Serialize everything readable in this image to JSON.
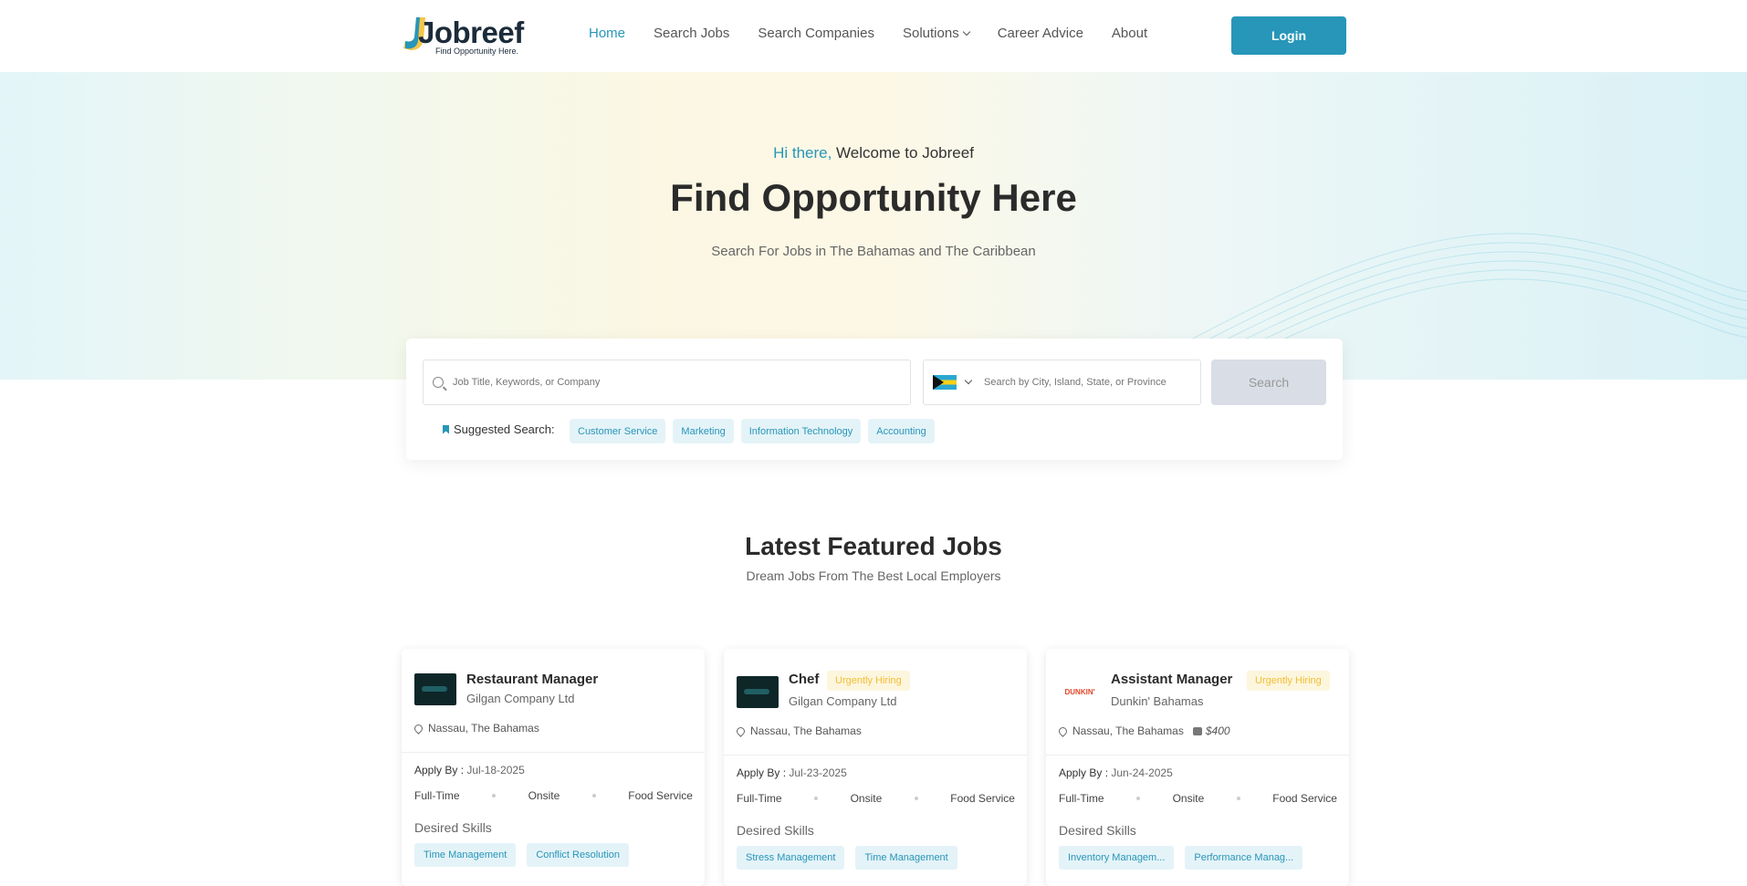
{
  "header": {
    "logo_text": "Jobreef",
    "logo_tagline": "Find Opportunity Here.",
    "nav": [
      {
        "label": "Home",
        "active": true
      },
      {
        "label": "Search Jobs"
      },
      {
        "label": "Search Companies"
      },
      {
        "label": "Solutions"
      },
      {
        "label": "Career Advice"
      },
      {
        "label": "About"
      }
    ],
    "login_label": "Login"
  },
  "hero": {
    "greeting_highlight": "Hi there,",
    "greeting_rest": "Welcome to Jobreef",
    "title": "Find Opportunity Here",
    "subtitle": "Search For Jobs in The Bahamas and The Caribbean"
  },
  "search": {
    "keyword_placeholder": "Job Title, Keywords, or Company",
    "location_placeholder": "Search by City, Island, State, or Province",
    "country_flag": "bahamas-flag",
    "button_label": "Search",
    "suggested_label": "Suggested Search:",
    "suggestions": [
      "Customer Service",
      "Marketing",
      "Information Technology",
      "Accounting"
    ]
  },
  "featured": {
    "title": "Latest Featured Jobs",
    "subtitle": "Dream Jobs From The Best Local Employers"
  },
  "jobs": [
    {
      "title": "Restaurant Manager",
      "urgent": "",
      "company": "Gilgan Company Ltd",
      "location": "Nassau, The Bahamas",
      "salary": "",
      "apply_label": "Apply By :",
      "apply_date": "Jul-18-2025",
      "type": "Full-Time",
      "mode": "Onsite",
      "category": "Food Service",
      "skills_heading": "Desired Skills",
      "skills": [
        "Time Management",
        "Conflict Resolution"
      ]
    },
    {
      "title": "Chef",
      "urgent": "Urgently Hiring",
      "company": "Gilgan Company Ltd",
      "location": "Nassau, The Bahamas",
      "salary": "",
      "apply_label": "Apply By :",
      "apply_date": "Jul-23-2025",
      "type": "Full-Time",
      "mode": "Onsite",
      "category": "Food Service",
      "skills_heading": "Desired Skills",
      "skills": [
        "Stress Management",
        "Time Management"
      ]
    },
    {
      "title": "Assistant Manager",
      "urgent": "Urgently Hiring",
      "company": "Dunkin' Bahamas",
      "logo_text": "DUNKIN'",
      "location": "Nassau, The Bahamas",
      "salary": "$400",
      "apply_label": "Apply By :",
      "apply_date": "Jun-24-2025",
      "type": "Full-Time",
      "mode": "Onsite",
      "category": "Food Service",
      "skills_heading": "Desired Skills",
      "skills": [
        "Inventory Managem...",
        "Performance Manag..."
      ]
    }
  ],
  "colors": {
    "accent": "#2796b8",
    "urgent": "#f2bd35",
    "chip_bg": "#e4f3f8"
  }
}
